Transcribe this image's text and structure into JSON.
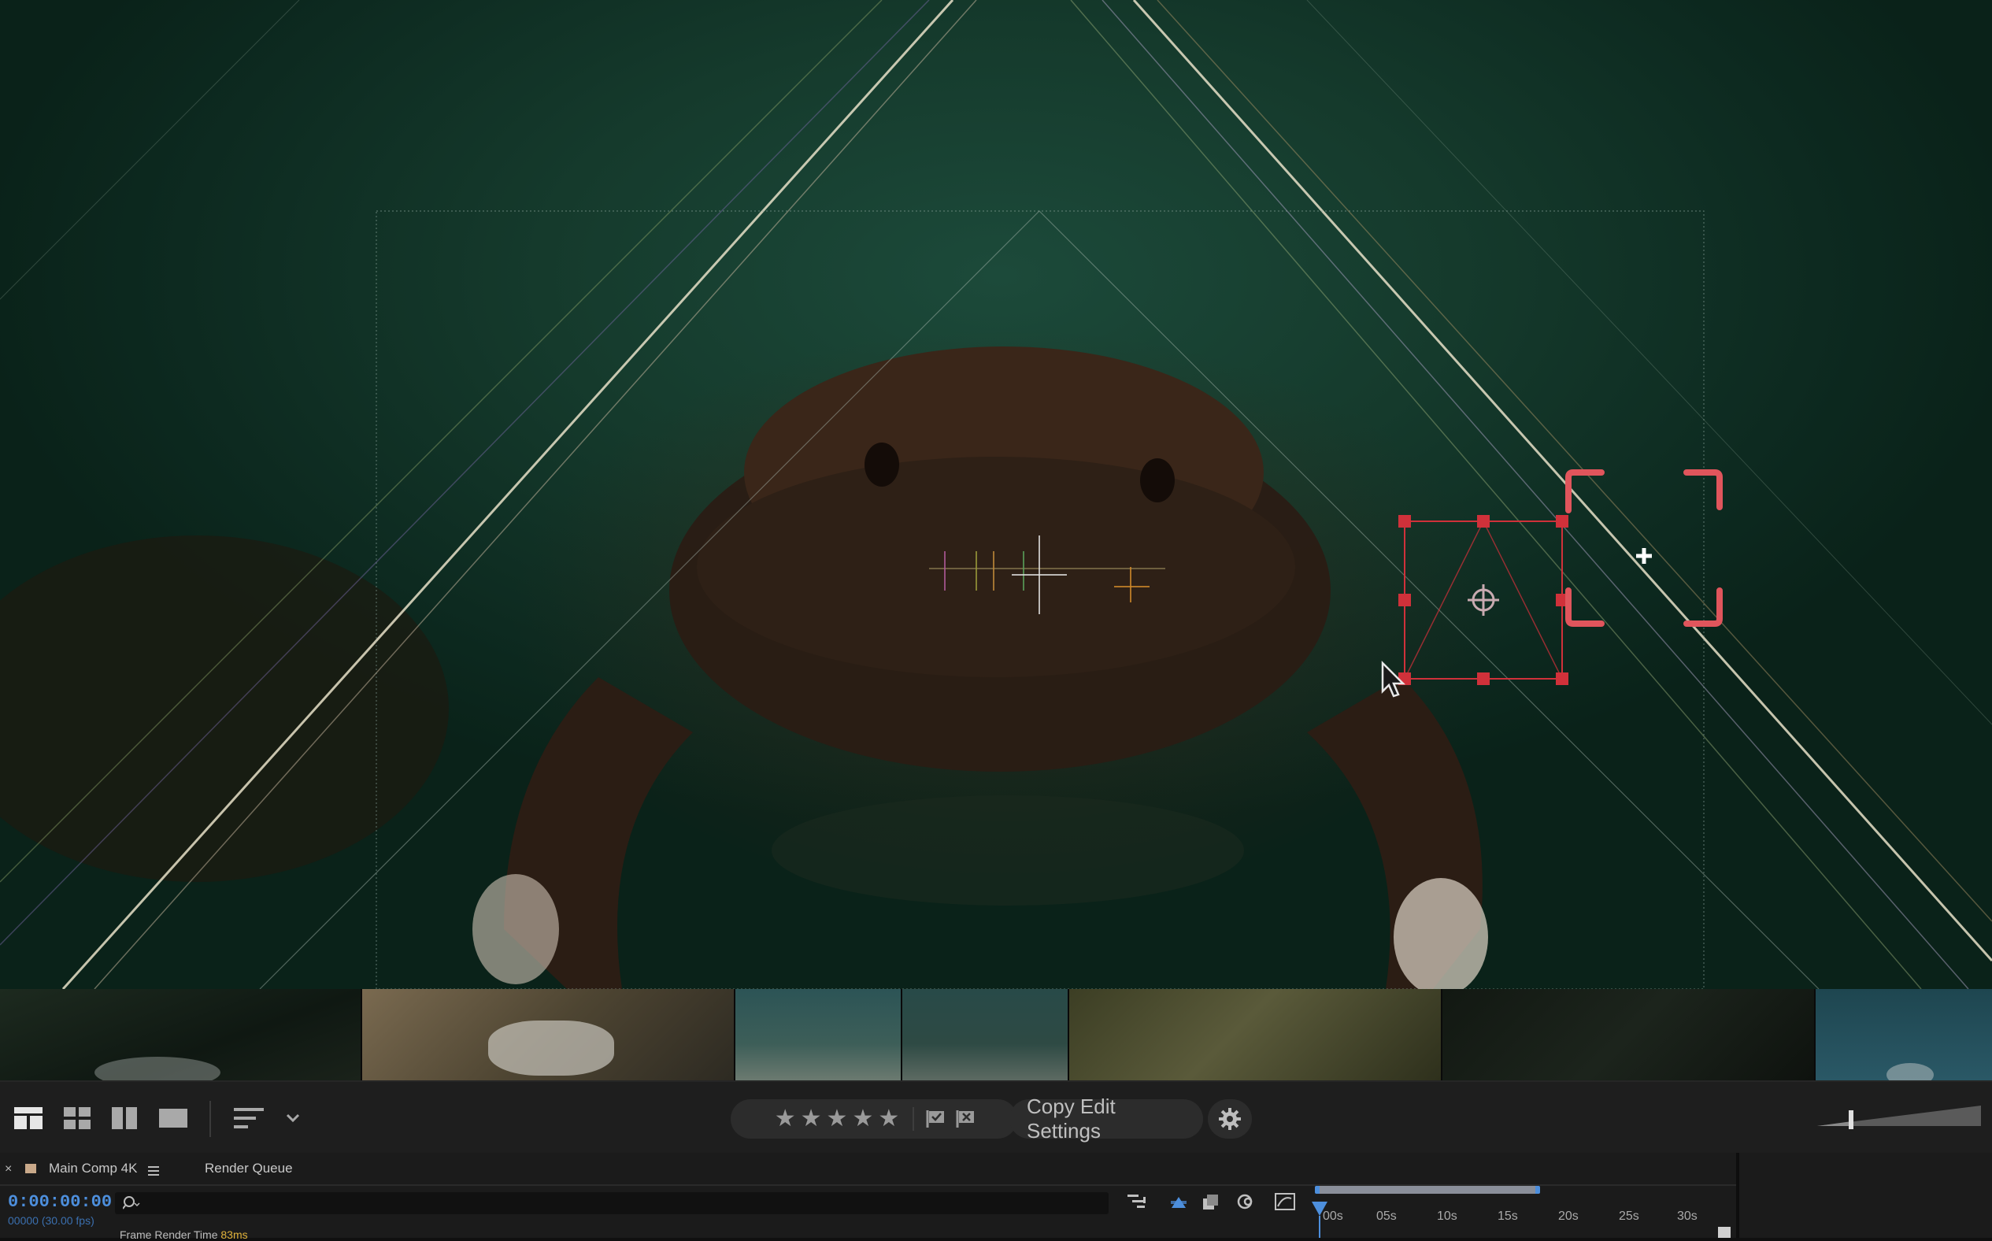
{
  "toolbar": {
    "copy_edit_settings_label": "Copy Edit Settings",
    "rating_stars": 5,
    "icons": [
      "grid-large-icon",
      "grid-small-icon",
      "split-view-icon",
      "single-view-icon",
      "sort-icon",
      "chevron-down-icon",
      "flag-pick-icon",
      "flag-reject-icon",
      "gear-icon",
      "size-slider-icon"
    ]
  },
  "timeline": {
    "tabs": [
      {
        "label": "Main Comp 4K",
        "active": true
      },
      {
        "label": "Render Queue",
        "active": false
      }
    ],
    "timecode": "0:00:00:00",
    "frame_info": "00000 (30.00 fps)",
    "render_time_label": "Frame Render Time",
    "render_time_value": "83ms",
    "ruler_labels": [
      "00s",
      "05s",
      "10s",
      "15s",
      "20s",
      "25s",
      "30s"
    ]
  },
  "colors": {
    "accent_blue": "#4d8fdd",
    "handle_red": "#d0313a",
    "bracket_red": "#e0555c",
    "render_time_yellow": "#e0b23a"
  }
}
